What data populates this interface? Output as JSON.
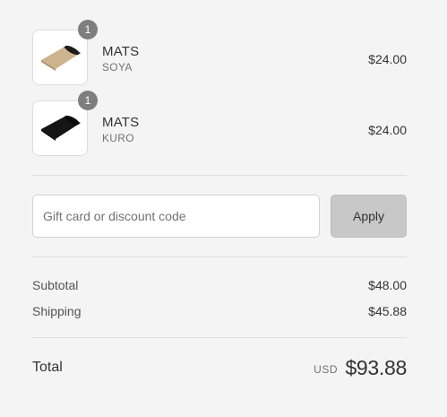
{
  "line_items": [
    {
      "name": "MATS",
      "variant": "SOYA",
      "price": "$24.00",
      "quantity": "1",
      "mat_color": "#cdb48e",
      "thumb_icon": "yoga-mat-beige"
    },
    {
      "name": "MATS",
      "variant": "KURO",
      "price": "$24.00",
      "quantity": "1",
      "mat_color": "#151515",
      "thumb_icon": "yoga-mat-black"
    }
  ],
  "discount": {
    "placeholder": "Gift card or discount code",
    "value": "",
    "apply_label": "Apply"
  },
  "summary": {
    "subtotal_label": "Subtotal",
    "subtotal_value": "$48.00",
    "shipping_label": "Shipping",
    "shipping_value": "$45.88"
  },
  "total": {
    "label": "Total",
    "currency": "USD",
    "amount": "$93.88"
  },
  "colors": {
    "background": "#f4f4f4",
    "badge": "#7e7e7e",
    "apply_button": "#c8c8c8"
  }
}
